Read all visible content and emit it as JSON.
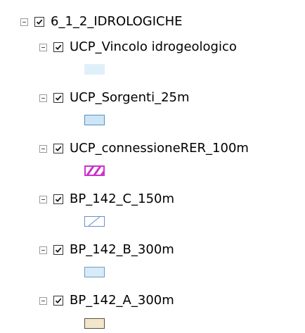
{
  "layer_tree": {
    "group": {
      "label": "6_1_2_IDROLOGICHE",
      "expanded": true,
      "checked": true
    },
    "layers": [
      {
        "label": "UCP_Vincolo idrogeologico",
        "checked": true,
        "expanded": true,
        "symbol": {
          "fill": "#dff0fb",
          "stroke": "#dff0fb",
          "pattern": "solid"
        }
      },
      {
        "label": "UCP_Sorgenti_25m",
        "checked": true,
        "expanded": true,
        "symbol": {
          "fill": "#cde6f7",
          "stroke": "#5a8fbf",
          "pattern": "solid"
        }
      },
      {
        "label": "UCP_connessioneRER_100m",
        "checked": true,
        "expanded": true,
        "symbol": {
          "fill": "#ffffff",
          "stroke": "#cc33cc",
          "pattern": "hatch-thick"
        }
      },
      {
        "label": "BP_142_C_150m",
        "checked": true,
        "expanded": true,
        "symbol": {
          "fill": "#ffffff",
          "stroke": "#6b8fc7",
          "pattern": "hatch-thin"
        }
      },
      {
        "label": "BP_142_B_300m",
        "checked": true,
        "expanded": true,
        "symbol": {
          "fill": "#d8ebf8",
          "stroke": "#6f9cc4",
          "pattern": "solid"
        }
      },
      {
        "label": "BP_142_A_300m",
        "checked": true,
        "expanded": true,
        "symbol": {
          "fill": "#f2e6cc",
          "stroke": "#5a5040",
          "pattern": "solid"
        }
      }
    ]
  },
  "icons": {
    "expander": "collapse-minus-icon",
    "checkbox": "checkmark-icon"
  }
}
